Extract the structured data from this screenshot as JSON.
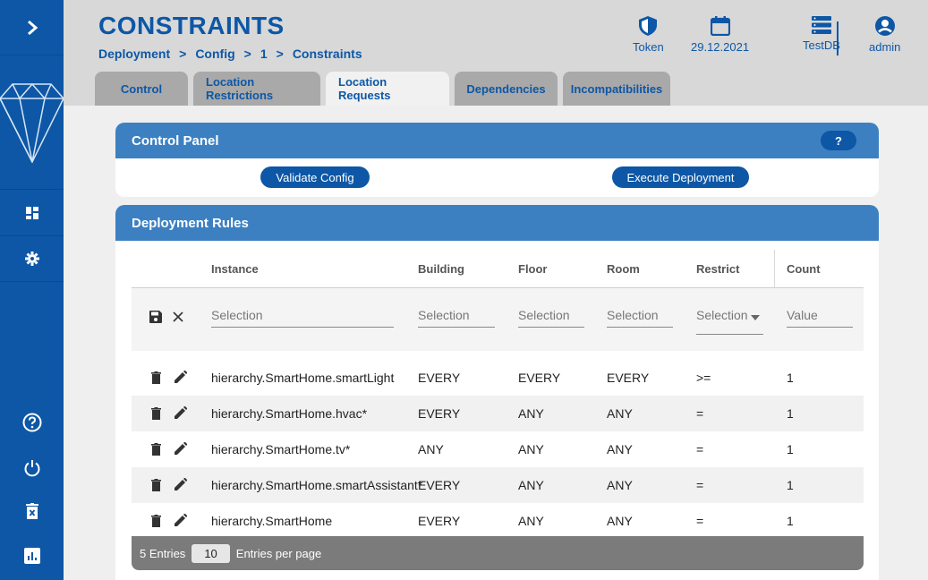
{
  "header": {
    "title": "CONSTRAINTS",
    "breadcrumb": [
      "Deployment",
      "Config",
      "1",
      "Constraints"
    ],
    "breadcrumb_sep": ">",
    "token_label": "Token",
    "date": "29.12.2021",
    "db_label": "TestDB",
    "user_label": "admin"
  },
  "tabs": [
    {
      "label": "Control",
      "active": false
    },
    {
      "label": "Location Restrictions",
      "active": false
    },
    {
      "label": "Location Requests",
      "active": true
    },
    {
      "label": "Dependencies",
      "active": false
    },
    {
      "label": "Incompatibilities",
      "active": false
    }
  ],
  "control_panel": {
    "title": "Control Panel",
    "help": "?",
    "validate": "Validate Config",
    "execute": "Execute Deployment"
  },
  "rules": {
    "title": "Deployment Rules",
    "columns": [
      "Instance",
      "Building",
      "Floor",
      "Room",
      "Restrict",
      "Count"
    ],
    "filters": {
      "instance": "Selection",
      "building": "Selection",
      "floor": "Selection",
      "room": "Selection",
      "restrict": "Selection",
      "count": "Value"
    },
    "rows": [
      [
        "hierarchy.SmartHome.smartLight",
        "EVERY",
        "EVERY",
        "EVERY",
        ">=",
        "1"
      ],
      [
        "hierarchy.SmartHome.hvac*",
        "EVERY",
        "ANY",
        "ANY",
        "=",
        "1"
      ],
      [
        "hierarchy.SmartHome.tv*",
        "ANY",
        "ANY",
        "ANY",
        "=",
        "1"
      ],
      [
        "hierarchy.SmartHome.smartAssistant*",
        "EVERY",
        "ANY",
        "ANY",
        "=",
        "1"
      ],
      [
        "hierarchy.SmartHome",
        "EVERY",
        "ANY",
        "ANY",
        "=",
        "1"
      ]
    ],
    "footer": {
      "entries": "5 Entries",
      "per_page_value": "10",
      "per_page_label": "Entries per page"
    }
  },
  "colors": {
    "primary": "#0d57a6",
    "panel_header": "#3d80c1"
  }
}
